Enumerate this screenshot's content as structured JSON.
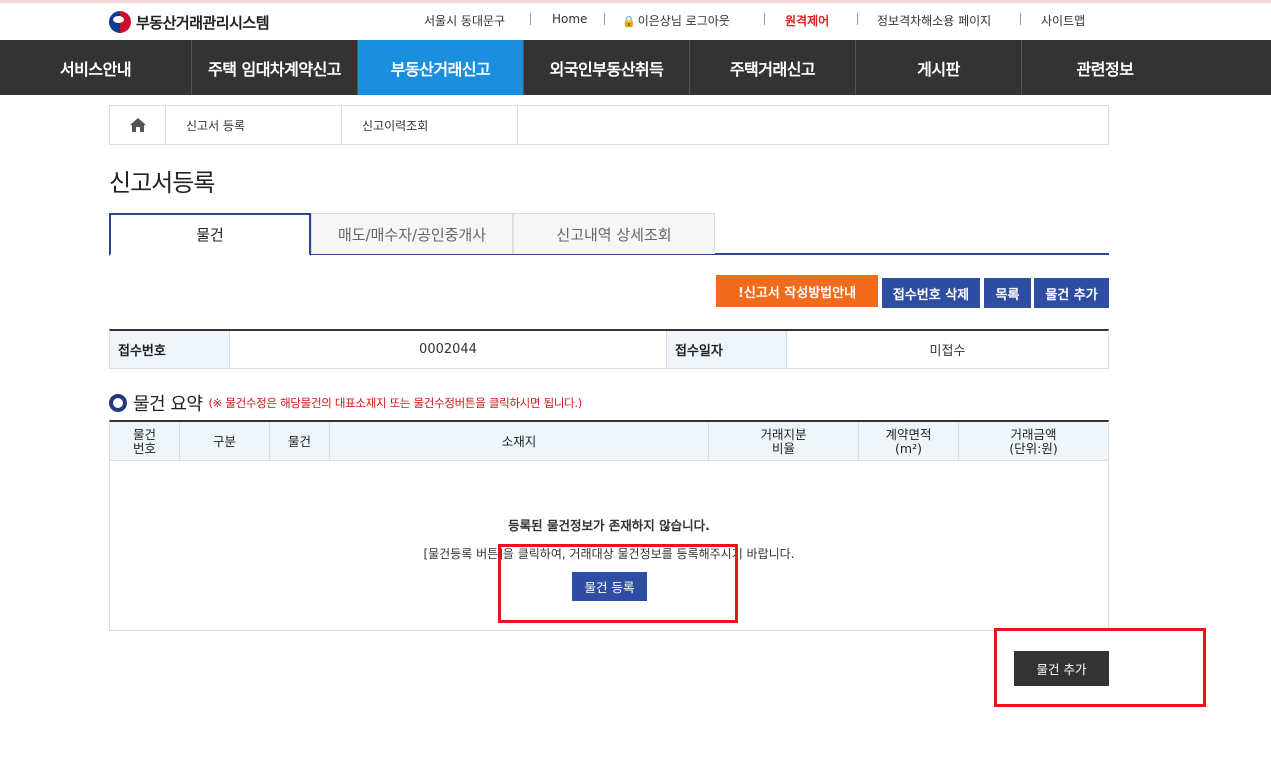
{
  "header": {
    "logo_text": "부동산거래관리시스템",
    "region": "서울시 동대문구",
    "home": "Home",
    "user_logout": "이은상님 로그아웃",
    "remote_control": "원격제어",
    "info_gap_page": "정보격차해소용 페이지",
    "sitemap": "사이트맵"
  },
  "nav": {
    "items": [
      "서비스안내",
      "주택 임대차계약신고",
      "부동산거래신고",
      "외국인부동산취득",
      "주택거래신고",
      "게시판",
      "관련정보"
    ],
    "active_index": 2
  },
  "breadcrumb": {
    "items": [
      "신고서 등록",
      "신고이력조회"
    ]
  },
  "page_title": "신고서등록",
  "tabs": [
    "물건",
    "매도/매수자/공인중개사",
    "신고내역 상세조회"
  ],
  "actions": {
    "guide": "!신고서 작성방법안내",
    "delete_receipt": "접수번호 삭제",
    "list": "목록",
    "add_item": "물건 추가"
  },
  "info": {
    "receipt_no_label": "접수번호",
    "receipt_no": "0002044",
    "receipt_date_label": "접수일자",
    "receipt_date": "미접수"
  },
  "summary": {
    "title": "물건 요약",
    "note": "(※ 물건수정은 해당물건의 대표소재지 또는 물건수정버튼을 클릭하시면 됩니다.)",
    "columns": [
      "물건\n번호",
      "구분",
      "물건",
      "소재지",
      "거래지분\n비율",
      "계약면적\n(m²)",
      "거래금액\n(단위:원)"
    ],
    "empty_title": "등록된 물건정보가 존재하지 않습니다.",
    "empty_desc": "[물건등록 버튼]을 클릭하여, 거래대상 물건정보를 등록해주시기 바랍니다.",
    "register_button": "물건 등록"
  },
  "bottom": {
    "add_item": "물건 추가"
  },
  "colors": {
    "nav_bg": "#333333",
    "nav_active": "#1b8fde",
    "btn_blue": "#2f4ea3",
    "btn_orange": "#f26a1b",
    "highlight": "#e8141b"
  }
}
